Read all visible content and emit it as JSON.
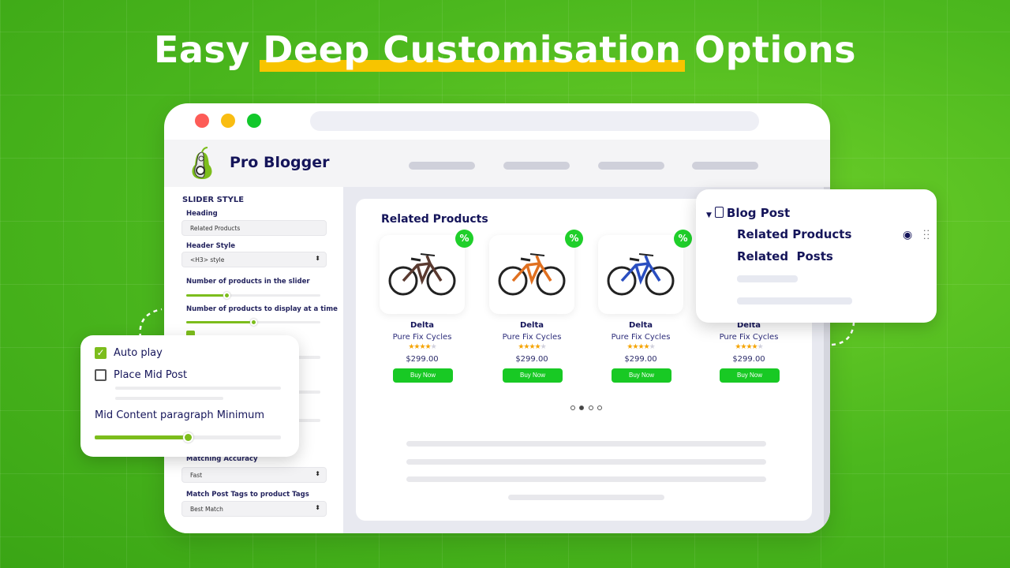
{
  "headline": {
    "before": "Easy ",
    "highlight": "Deep Customisation",
    "after": " Options",
    "highlight_color": "#f7c400"
  },
  "app": {
    "name": "Pro Blogger",
    "logo": "pear-logo",
    "accent": "#7cbd1c"
  },
  "settings": {
    "section_title": "SLIDER STYLE",
    "heading_label": "Heading",
    "heading_value": "Related Products",
    "header_style_label": "Header Style",
    "header_style_value": "<H3> style",
    "num_products_label": "Number of products in the slider",
    "num_products_level": 0.3,
    "num_display_label": "Number of products to display at a time",
    "num_display_level": 0.5,
    "matching_label": "Matching Accuracy",
    "matching_value": "Fast",
    "match_tags_label": "Match Post Tags to product Tags",
    "match_tags_value": "Best Match"
  },
  "main": {
    "section_title": "Related Products",
    "badge": "%",
    "products": [
      {
        "name": "Delta",
        "brand": "Pure Fix Cycles",
        "rating": 4,
        "price": "$299.00",
        "button": "Buy Now",
        "frame": "#5a3a30"
      },
      {
        "name": "Delta",
        "brand": "Pure Fix Cycles",
        "rating": 4,
        "price": "$299.00",
        "button": "Buy Now",
        "frame": "#e07020"
      },
      {
        "name": "Delta",
        "brand": "Pure Fix Cycles",
        "rating": 4,
        "price": "$299.00",
        "button": "Buy Now",
        "frame": "#2a4ec0"
      },
      {
        "name": "Delta",
        "brand": "Pure Fix Cycles",
        "rating": 4,
        "price": "$299.00",
        "button": "Buy Now",
        "frame": "#333333"
      }
    ],
    "pagination": {
      "pages": 4,
      "current": 2
    }
  },
  "options_popup": {
    "autoplay_label": "Auto play",
    "autoplay_checked": true,
    "midpost_label": "Place Mid Post",
    "midpost_checked": false,
    "mid_content_label": "Mid Content paragraph Minimum",
    "mid_content_level": 0.5
  },
  "blog_popup": {
    "title": "Blog Post",
    "items": [
      "Related Products",
      "Related  Posts"
    ]
  }
}
